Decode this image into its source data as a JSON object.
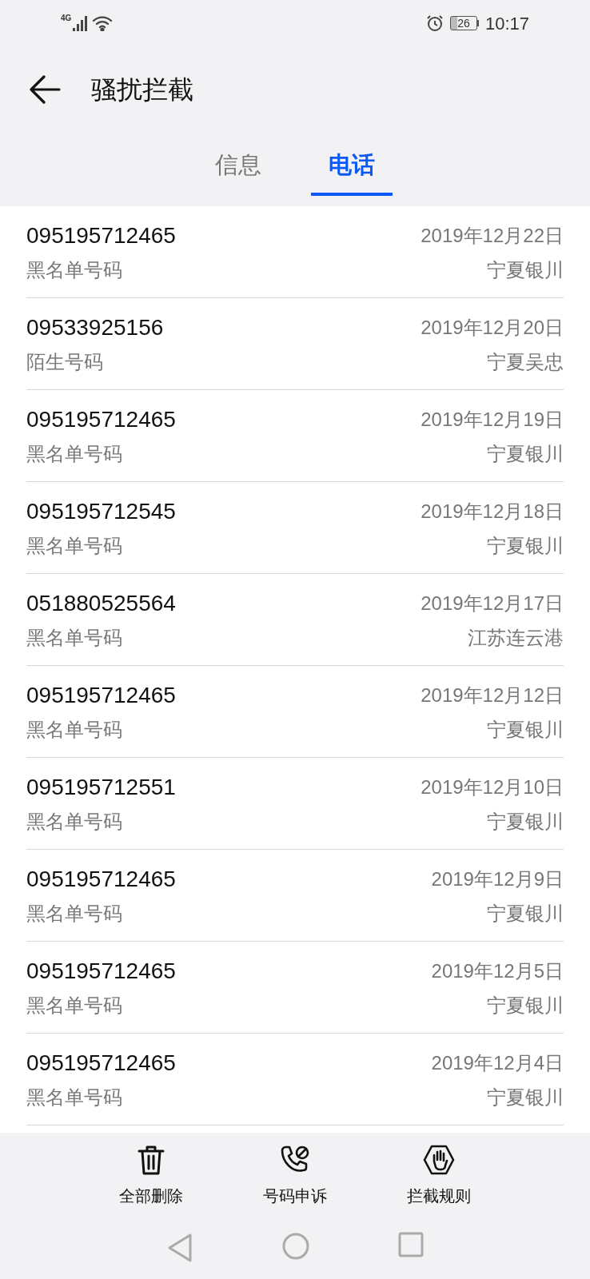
{
  "status_bar": {
    "network": "4G",
    "battery": "26",
    "time": "10:17"
  },
  "header": {
    "title": "骚扰拦截"
  },
  "tabs": [
    {
      "label": "信息",
      "selected": false
    },
    {
      "label": "电话",
      "selected": true
    }
  ],
  "calls": [
    {
      "number": "095195712465",
      "type": "黑名单号码",
      "date": "2019年12月22日",
      "location": "宁夏银川"
    },
    {
      "number": "09533925156",
      "type": "陌生号码",
      "date": "2019年12月20日",
      "location": "宁夏吴忠"
    },
    {
      "number": "095195712465",
      "type": "黑名单号码",
      "date": "2019年12月19日",
      "location": "宁夏银川"
    },
    {
      "number": "095195712545",
      "type": "黑名单号码",
      "date": "2019年12月18日",
      "location": "宁夏银川"
    },
    {
      "number": "051880525564",
      "type": "黑名单号码",
      "date": "2019年12月17日",
      "location": "江苏连云港"
    },
    {
      "number": "095195712465",
      "type": "黑名单号码",
      "date": "2019年12月12日",
      "location": "宁夏银川"
    },
    {
      "number": "095195712551",
      "type": "黑名单号码",
      "date": "2019年12月10日",
      "location": "宁夏银川"
    },
    {
      "number": "095195712465",
      "type": "黑名单号码",
      "date": "2019年12月9日",
      "location": "宁夏银川"
    },
    {
      "number": "095195712465",
      "type": "黑名单号码",
      "date": "2019年12月5日",
      "location": "宁夏银川"
    },
    {
      "number": "095195712465",
      "type": "黑名单号码",
      "date": "2019年12月4日",
      "location": "宁夏银川"
    }
  ],
  "actions": [
    {
      "kind": "delete",
      "label": "全部删除"
    },
    {
      "kind": "appeal",
      "label": "号码申诉"
    },
    {
      "kind": "rules",
      "label": "拦截规则"
    }
  ]
}
